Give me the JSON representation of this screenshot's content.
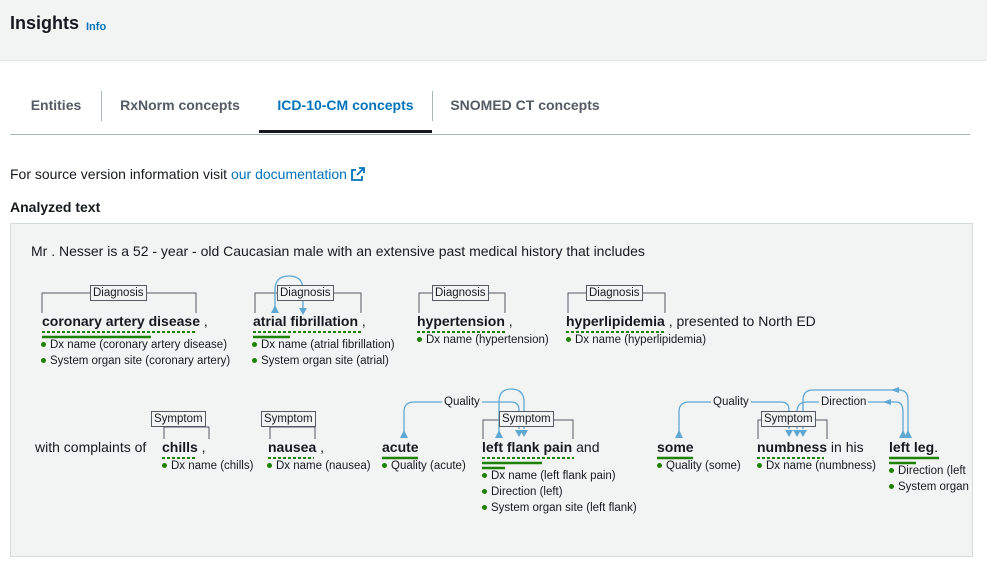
{
  "header": {
    "title": "Insights",
    "info_label": "Info"
  },
  "tabs": [
    {
      "label": "Entities",
      "active": false
    },
    {
      "label": "RxNorm concepts",
      "active": false
    },
    {
      "label": "ICD-10-CM concepts",
      "active": true
    },
    {
      "label": "SNOMED CT concepts",
      "active": false
    }
  ],
  "source_info": {
    "prefix": "For source version information visit ",
    "link_text": "our documentation",
    "icon": "external-link-icon"
  },
  "analyzed_text_heading": "Analyzed text",
  "analyzed": {
    "line1": "Mr . Nesser is a 52 - year - old Caucasian male with an extensive past medical history that includes",
    "line2": {
      "entities": [
        {
          "text": "coronary artery disease",
          "trail": " ,",
          "tag": "Diagnosis",
          "attributes": [
            "Dx name (coronary artery disease)",
            "System organ site (coronary artery)"
          ]
        },
        {
          "text": "atrial fibrillation",
          "trail": " ,",
          "tag": "Diagnosis",
          "attributes": [
            "Dx name (atrial fibrillation)",
            "System organ site (atrial)"
          ]
        },
        {
          "text": "hypertension",
          "trail": " ,",
          "tag": "Diagnosis",
          "attributes": [
            "Dx name (hypertension)"
          ]
        },
        {
          "text": "hyperlipidemia",
          "trail": " , presented to North ED",
          "tag": "Diagnosis",
          "attributes": [
            "Dx name (hyperlipidemia)"
          ]
        }
      ]
    },
    "line3": {
      "lead": "with complaints of",
      "chills": {
        "text": "chills",
        "trail": " ,",
        "tag": "Symptom",
        "attributes": [
          "Dx name (chills)"
        ]
      },
      "nausea": {
        "text": "nausea",
        "trail": " ,",
        "tag": "Symptom",
        "attributes": [
          "Dx name (nausea)"
        ]
      },
      "acute": {
        "text": "acute",
        "attributes": [
          "Quality (acute)"
        ]
      },
      "flank": {
        "text": "left flank pain",
        "trail": " and",
        "tag": "Symptom",
        "attributes": [
          "Dx name (left flank pain)",
          "Direction (left)",
          "System organ site (left flank)"
        ]
      },
      "some": {
        "text": "some",
        "attributes": [
          "Quality (some)"
        ]
      },
      "numbness": {
        "text": "numbness",
        "trail": " in his",
        "tag": "Symptom",
        "attributes": [
          "Dx name (numbness)"
        ]
      },
      "leg": {
        "text": "left leg",
        "trail": ".",
        "attributes": [
          "Direction (left",
          "System organ"
        ]
      },
      "relations": {
        "quality1": "Quality",
        "quality2": "Quality",
        "direction": "Direction"
      }
    }
  },
  "colors": {
    "accent": "#0073bb",
    "underline_green": "#1d8102",
    "arrow_blue": "#5fa8d3"
  }
}
